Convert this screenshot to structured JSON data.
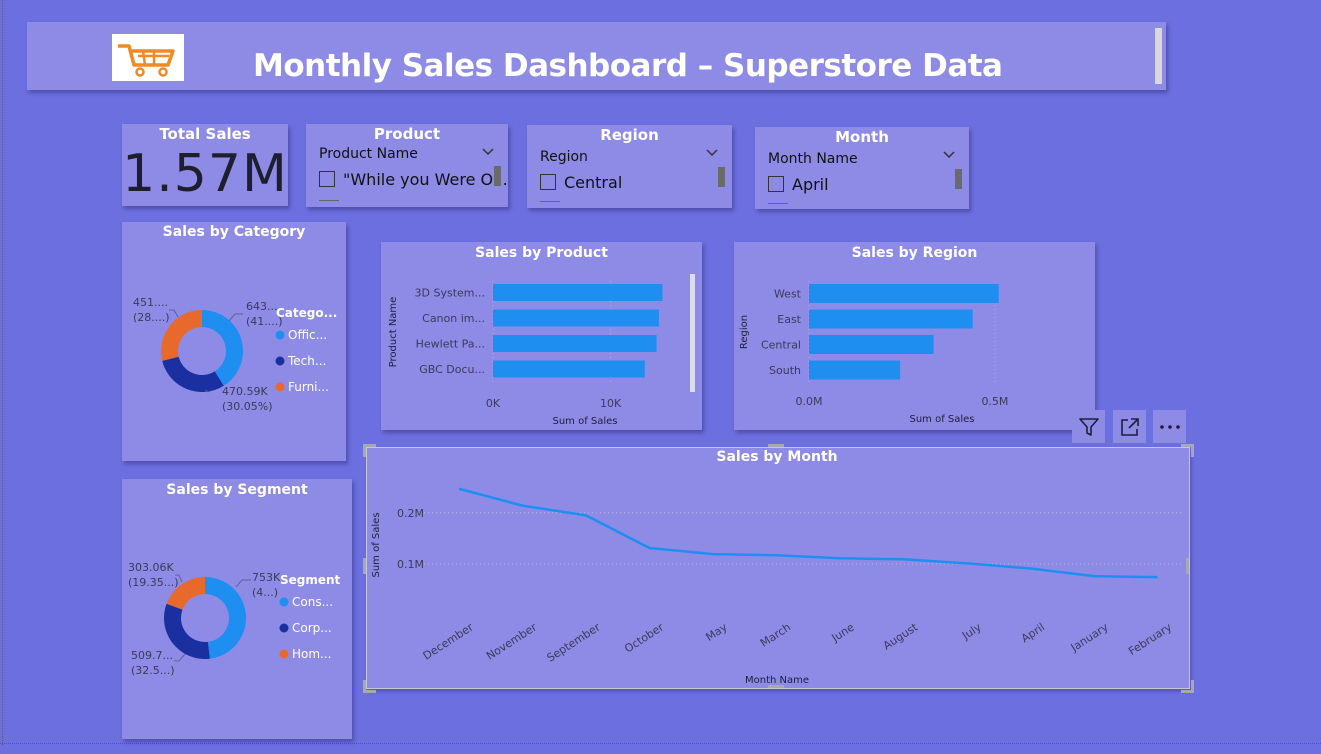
{
  "header": {
    "title": "Monthly Sales Dashboard – Superstore Data",
    "logo_icon": "shopping-cart-icon"
  },
  "kpi": {
    "title": "Total Sales",
    "value": "1.57M"
  },
  "slicers": {
    "product": {
      "title": "Product",
      "label": "Product Name",
      "first_item": "\"While you Were O..."
    },
    "region": {
      "title": "Region",
      "label": "Region",
      "first_item": "Central"
    },
    "month": {
      "title": "Month",
      "label": "Month Name",
      "first_item": "April"
    }
  },
  "colors": {
    "background": "#6c6fe0",
    "card": "#8d8be6",
    "bar": "#1f8ef1",
    "donut_light_blue": "#1f8ef1",
    "donut_dark_blue": "#1a2fa0",
    "donut_orange": "#e8692c"
  },
  "visual_toolbar": {
    "filter_icon": "filter-icon",
    "focus_icon": "focus-mode-icon",
    "more_icon": "more-options-icon"
  },
  "chart_data": [
    {
      "id": "category",
      "type": "pie",
      "variant": "donut",
      "title": "Sales by Category",
      "legend_title": "Catego...",
      "legend": [
        "Offic...",
        "Tech...",
        "Furni..."
      ],
      "values": [
        643.28,
        470.59,
        451.92
      ],
      "labels": [
        {
          "line1": "643....",
          "line2": "(41....)"
        },
        {
          "line1": "470.59K",
          "line2": "(30.05%)"
        },
        {
          "line1": "451....",
          "line2": "(28....)"
        }
      ]
    },
    {
      "id": "segment",
      "type": "pie",
      "variant": "donut",
      "title": "Sales by Segment",
      "legend_title": "Segment",
      "legend": [
        "Cons...",
        "Corp...",
        "Hom..."
      ],
      "values": [
        753,
        509.7,
        303.06
      ],
      "labels": [
        {
          "line1": "753K",
          "line2": "(4...)"
        },
        {
          "line1": "509.7...",
          "line2": "(32.5...)"
        },
        {
          "line1": "303.06K",
          "line2": "(19.35...)"
        }
      ]
    },
    {
      "id": "product",
      "type": "bar",
      "orientation": "horizontal",
      "title": "Sales by Product",
      "xlabel": "Sum of Sales",
      "ylabel": "Product Name",
      "categories": [
        "3D System...",
        "Canon im...",
        "Hewlett Pa...",
        "GBC Docu..."
      ],
      "values": [
        14400,
        14100,
        13900,
        12900
      ],
      "xlim": [
        0,
        17000
      ],
      "xticks": [
        "0K",
        "10K"
      ],
      "xtick_values": [
        0,
        10000
      ]
    },
    {
      "id": "region",
      "type": "bar",
      "orientation": "horizontal",
      "title": "Sales by Region",
      "xlabel": "Sum of Sales",
      "ylabel": "Region",
      "categories": [
        "West",
        "East",
        "Central",
        "South"
      ],
      "values": [
        510000,
        440000,
        335000,
        245000
      ],
      "xlim": [
        0,
        640000
      ],
      "xticks": [
        "0.0M",
        "0.5M"
      ],
      "xtick_values": [
        0,
        500000
      ]
    },
    {
      "id": "month",
      "type": "line",
      "title": "Sales by Month",
      "xlabel": "Month Name",
      "ylabel": "Sum of Sales",
      "categories": [
        "December",
        "November",
        "September",
        "October",
        "May",
        "March",
        "June",
        "August",
        "July",
        "April",
        "January",
        "February"
      ],
      "values": [
        247000,
        214000,
        195000,
        131000,
        119000,
        117000,
        111000,
        109000,
        101000,
        91000,
        76000,
        74000
      ],
      "ylim": [
        0,
        270000
      ],
      "yticks": [
        "0.1M",
        "0.2M"
      ],
      "ytick_values": [
        100000,
        200000
      ],
      "grid": true
    }
  ]
}
